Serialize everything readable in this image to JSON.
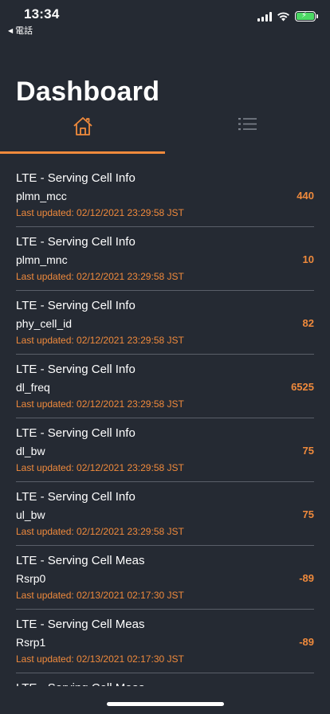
{
  "status_bar": {
    "time": "13:34",
    "back_app": "電話",
    "battery_level": 1.0,
    "colors": {
      "battery": "#4cd964"
    }
  },
  "header": {
    "title": "Dashboard"
  },
  "tabs": [
    {
      "icon": "home-icon",
      "active": true
    },
    {
      "icon": "list-icon",
      "active": false
    }
  ],
  "colors": {
    "accent": "#f08a3c",
    "background": "#252a33",
    "divider": "#5a5f69",
    "inactive_icon": "#7d828c"
  },
  "items": [
    {
      "title": "LTE - Serving Cell Info",
      "key": "plmn_mcc",
      "value": "440",
      "updated": "Last updated: 02/12/2021 23:29:58 JST"
    },
    {
      "title": "LTE - Serving Cell Info",
      "key": "plmn_mnc",
      "value": "10",
      "updated": "Last updated: 02/12/2021 23:29:58 JST"
    },
    {
      "title": "LTE - Serving Cell Info",
      "key": "phy_cell_id",
      "value": "82",
      "updated": "Last updated: 02/12/2021 23:29:58 JST"
    },
    {
      "title": "LTE - Serving Cell Info",
      "key": "dl_freq",
      "value": "6525",
      "updated": "Last updated: 02/12/2021 23:29:58 JST"
    },
    {
      "title": "LTE - Serving Cell Info",
      "key": "dl_bw",
      "value": "75",
      "updated": "Last updated: 02/12/2021 23:29:58 JST"
    },
    {
      "title": "LTE - Serving Cell Info",
      "key": "ul_bw",
      "value": "75",
      "updated": "Last updated: 02/12/2021 23:29:58 JST"
    },
    {
      "title": "LTE - Serving Cell Meas",
      "key": "Rsrp0",
      "value": "-89",
      "updated": "Last updated: 02/13/2021 02:17:30 JST"
    },
    {
      "title": "LTE - Serving Cell Meas",
      "key": "Rsrp1",
      "value": "-89",
      "updated": "Last updated: 02/13/2021 02:17:30 JST"
    },
    {
      "title": "LTE - Serving Cell Meas",
      "key": "",
      "value": "",
      "updated": ""
    }
  ]
}
